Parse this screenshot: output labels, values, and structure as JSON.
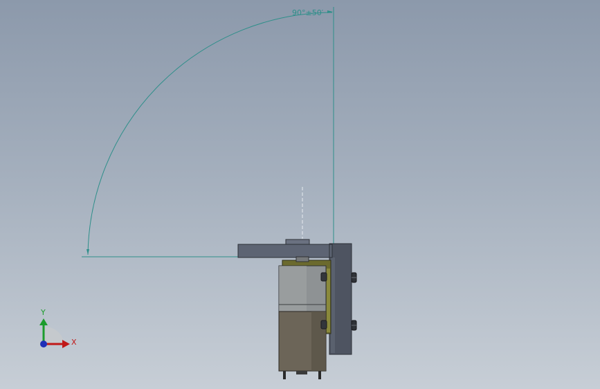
{
  "viewport": {
    "dimension": {
      "text": "90°±50′"
    },
    "triad": {
      "x_label": "X",
      "y_label": "Y"
    },
    "colors": {
      "dimension": "#2e8f8a",
      "arm": "#5d6473",
      "bracket": "#4e5461",
      "plate": "#6b6a2e",
      "motor_top": "#8e9294",
      "motor_bottom": "#6c6558",
      "axis_x": "#c01818",
      "axis_y": "#1c9c2c",
      "axis_z": "#1f2fb8"
    }
  }
}
